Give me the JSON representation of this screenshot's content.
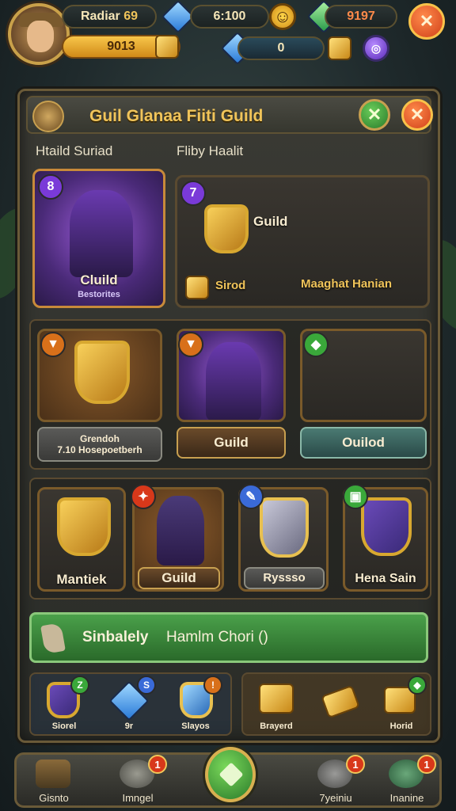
{
  "topbar": {
    "player_name": "Radiar",
    "player_level": "69",
    "gold_count": "9013",
    "gem_count": "6:100",
    "gem_count_2": "0",
    "emerald_count": "9197"
  },
  "panel": {
    "title": "Guil Glanaa Fiiti Guild",
    "col_left": "Htaild Suriad",
    "col_right": "Fliby Haalit"
  },
  "featured": {
    "hero_card_label": "Cluild",
    "hero_card_sub": "Bestorites",
    "hero_card_badge": "8",
    "reward_badge": "7",
    "reward_title": "Guild",
    "reward_resource": "Sirod",
    "reward_caption": "Maaghat Hanian"
  },
  "row2": [
    {
      "badge": "",
      "plate": "Grendoh",
      "plate_sub": "7.10  Hosepoetberh"
    },
    {
      "badge": "",
      "plate": "Guild"
    },
    {
      "badge": "",
      "plate": "Ouilod"
    }
  ],
  "row3": [
    {
      "badge": "",
      "label": "Mantiek"
    },
    {
      "badge": "",
      "label": "Guild"
    },
    {
      "badge": "",
      "label": "Ryssso"
    },
    {
      "badge": "",
      "label": "Hena Sain"
    }
  ],
  "banner": {
    "text": "Sinbalely",
    "text_2": "Hamlm Chori ()"
  },
  "inventory": [
    {
      "badge": "Z",
      "label": "Siorel"
    },
    {
      "badge": "S",
      "label": "9r"
    },
    {
      "badge": "",
      "label": "Slayos"
    },
    {
      "label": "Brayerd"
    },
    {
      "label": ""
    },
    {
      "label": "Horid"
    }
  ],
  "nav": [
    {
      "label": "Gisnto",
      "badge": ""
    },
    {
      "label": "Imngel",
      "badge": "1"
    },
    {
      "label": "",
      "badge": ""
    },
    {
      "label": "7yeiniu",
      "badge": "1"
    },
    {
      "label": "Inanine",
      "badge": "1"
    }
  ],
  "colors": {
    "accent_gold": "#f0c45a",
    "panel_border": "#6a5a38",
    "banner_green": "#3a8a3a"
  }
}
